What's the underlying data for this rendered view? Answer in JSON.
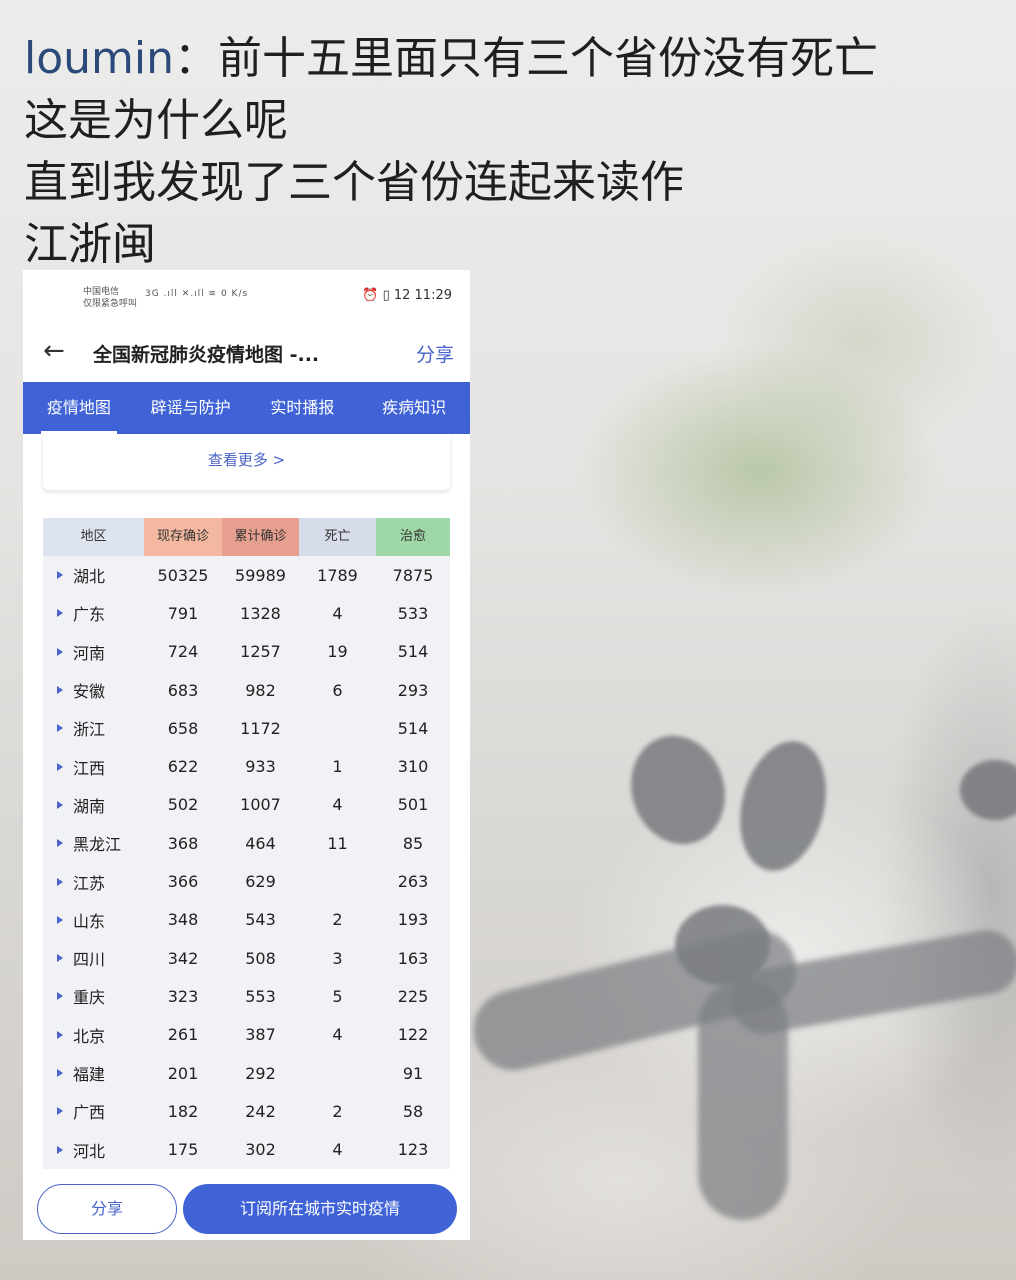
{
  "caption": {
    "user": "loumin",
    "line1_rest": "：前十五里面只有三个省份没有死亡",
    "line2": "这是为什么呢",
    "line3": "直到我发现了三个省份连起来读作",
    "line4": "江浙闽"
  },
  "status": {
    "carrier1": "中国电信",
    "carrier2": "仅限紧急呼叫",
    "signal": "3G .ıll ✕.ıll ≋ 0 K/s",
    "right": "⏰ ▯ 12 11:29"
  },
  "titlebar": {
    "back": "←",
    "title": "全国新冠肺炎疫情地图 -...",
    "share": "分享"
  },
  "tabs": [
    "疫情地图",
    "辟谣与防护",
    "实时播报",
    "疾病知识"
  ],
  "more": "查看更多 >",
  "table": {
    "headers": [
      "地区",
      "现存确诊",
      "累计确诊",
      "死亡",
      "治愈"
    ],
    "rows": [
      [
        "湖北",
        "50325",
        "59989",
        "1789",
        "7875"
      ],
      [
        "广东",
        "791",
        "1328",
        "4",
        "533"
      ],
      [
        "河南",
        "724",
        "1257",
        "19",
        "514"
      ],
      [
        "安徽",
        "683",
        "982",
        "6",
        "293"
      ],
      [
        "浙江",
        "658",
        "1172",
        "",
        "514"
      ],
      [
        "江西",
        "622",
        "933",
        "1",
        "310"
      ],
      [
        "湖南",
        "502",
        "1007",
        "4",
        "501"
      ],
      [
        "黑龙江",
        "368",
        "464",
        "11",
        "85"
      ],
      [
        "江苏",
        "366",
        "629",
        "",
        "263"
      ],
      [
        "山东",
        "348",
        "543",
        "2",
        "193"
      ],
      [
        "四川",
        "342",
        "508",
        "3",
        "163"
      ],
      [
        "重庆",
        "323",
        "553",
        "5",
        "225"
      ],
      [
        "北京",
        "261",
        "387",
        "4",
        "122"
      ],
      [
        "福建",
        "201",
        "292",
        "",
        "91"
      ],
      [
        "广西",
        "182",
        "242",
        "2",
        "58"
      ],
      [
        "河北",
        "175",
        "302",
        "4",
        "123"
      ]
    ]
  },
  "bottom": {
    "share": "分享",
    "subscribe": "订阅所在城市实时疫情"
  }
}
